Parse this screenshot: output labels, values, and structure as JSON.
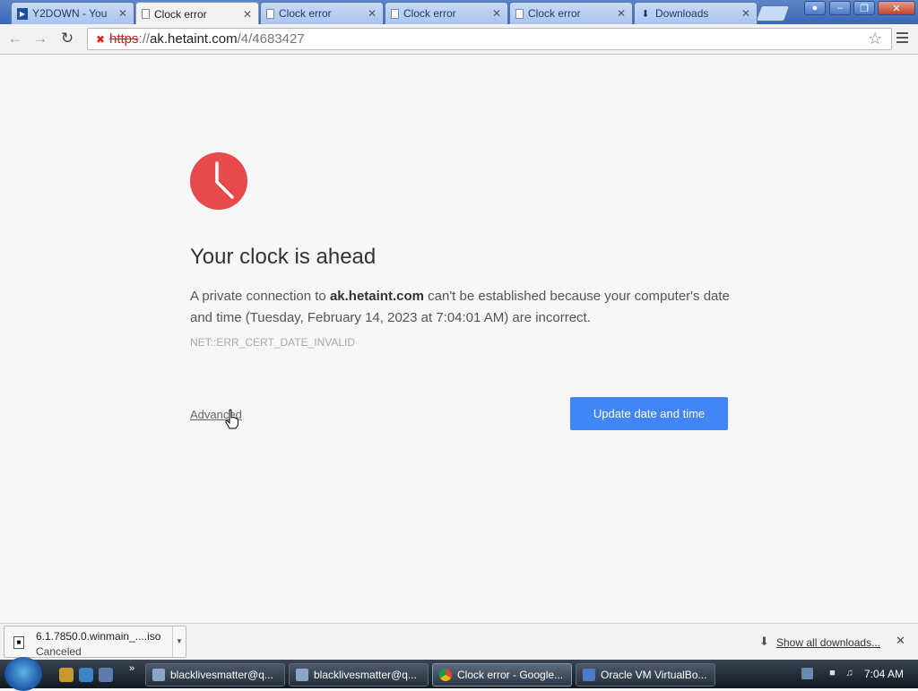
{
  "tabs": [
    {
      "label": "Y2DOWN - You",
      "icon": "y2down-favicon",
      "active": false
    },
    {
      "label": "Clock error",
      "icon": "page-icon",
      "active": true
    },
    {
      "label": "Clock error",
      "icon": "page-icon",
      "active": false
    },
    {
      "label": "Clock error",
      "icon": "page-icon",
      "active": false
    },
    {
      "label": "Clock error",
      "icon": "page-icon",
      "active": false
    },
    {
      "label": "Downloads",
      "icon": "download-icon",
      "active": false
    }
  ],
  "omnibox": {
    "scheme": "https",
    "separator": "://",
    "host": "ak.hetaint.com",
    "path": "/4/4683427"
  },
  "error": {
    "title": "Your clock is ahead",
    "message_prefix": "A private connection to ",
    "host": "ak.hetaint.com",
    "message_suffix": " can't be established because your computer's date and time (Tuesday, February 14, 2023 at 7:04:01 AM) are incorrect.",
    "code": "NET::ERR_CERT_DATE_INVALID",
    "advanced_label": "Advanced",
    "update_button": "Update date and time"
  },
  "download_shelf": {
    "item_name": "6.1.7850.0.winmain_....iso",
    "item_status": "Canceled",
    "show_all": "Show all downloads..."
  },
  "taskbar": {
    "buttons": [
      {
        "label": "blacklivesmatter@q...",
        "active": false
      },
      {
        "label": "blacklivesmatter@q...",
        "active": false
      },
      {
        "label": "Clock error - Google...",
        "active": true
      },
      {
        "label": "Oracle VM VirtualBo...",
        "active": false
      }
    ],
    "time": "7:04 AM"
  },
  "colors": {
    "accent": "#4285f4",
    "clock_red": "#e64a4a",
    "error_scheme": "#c22222"
  }
}
